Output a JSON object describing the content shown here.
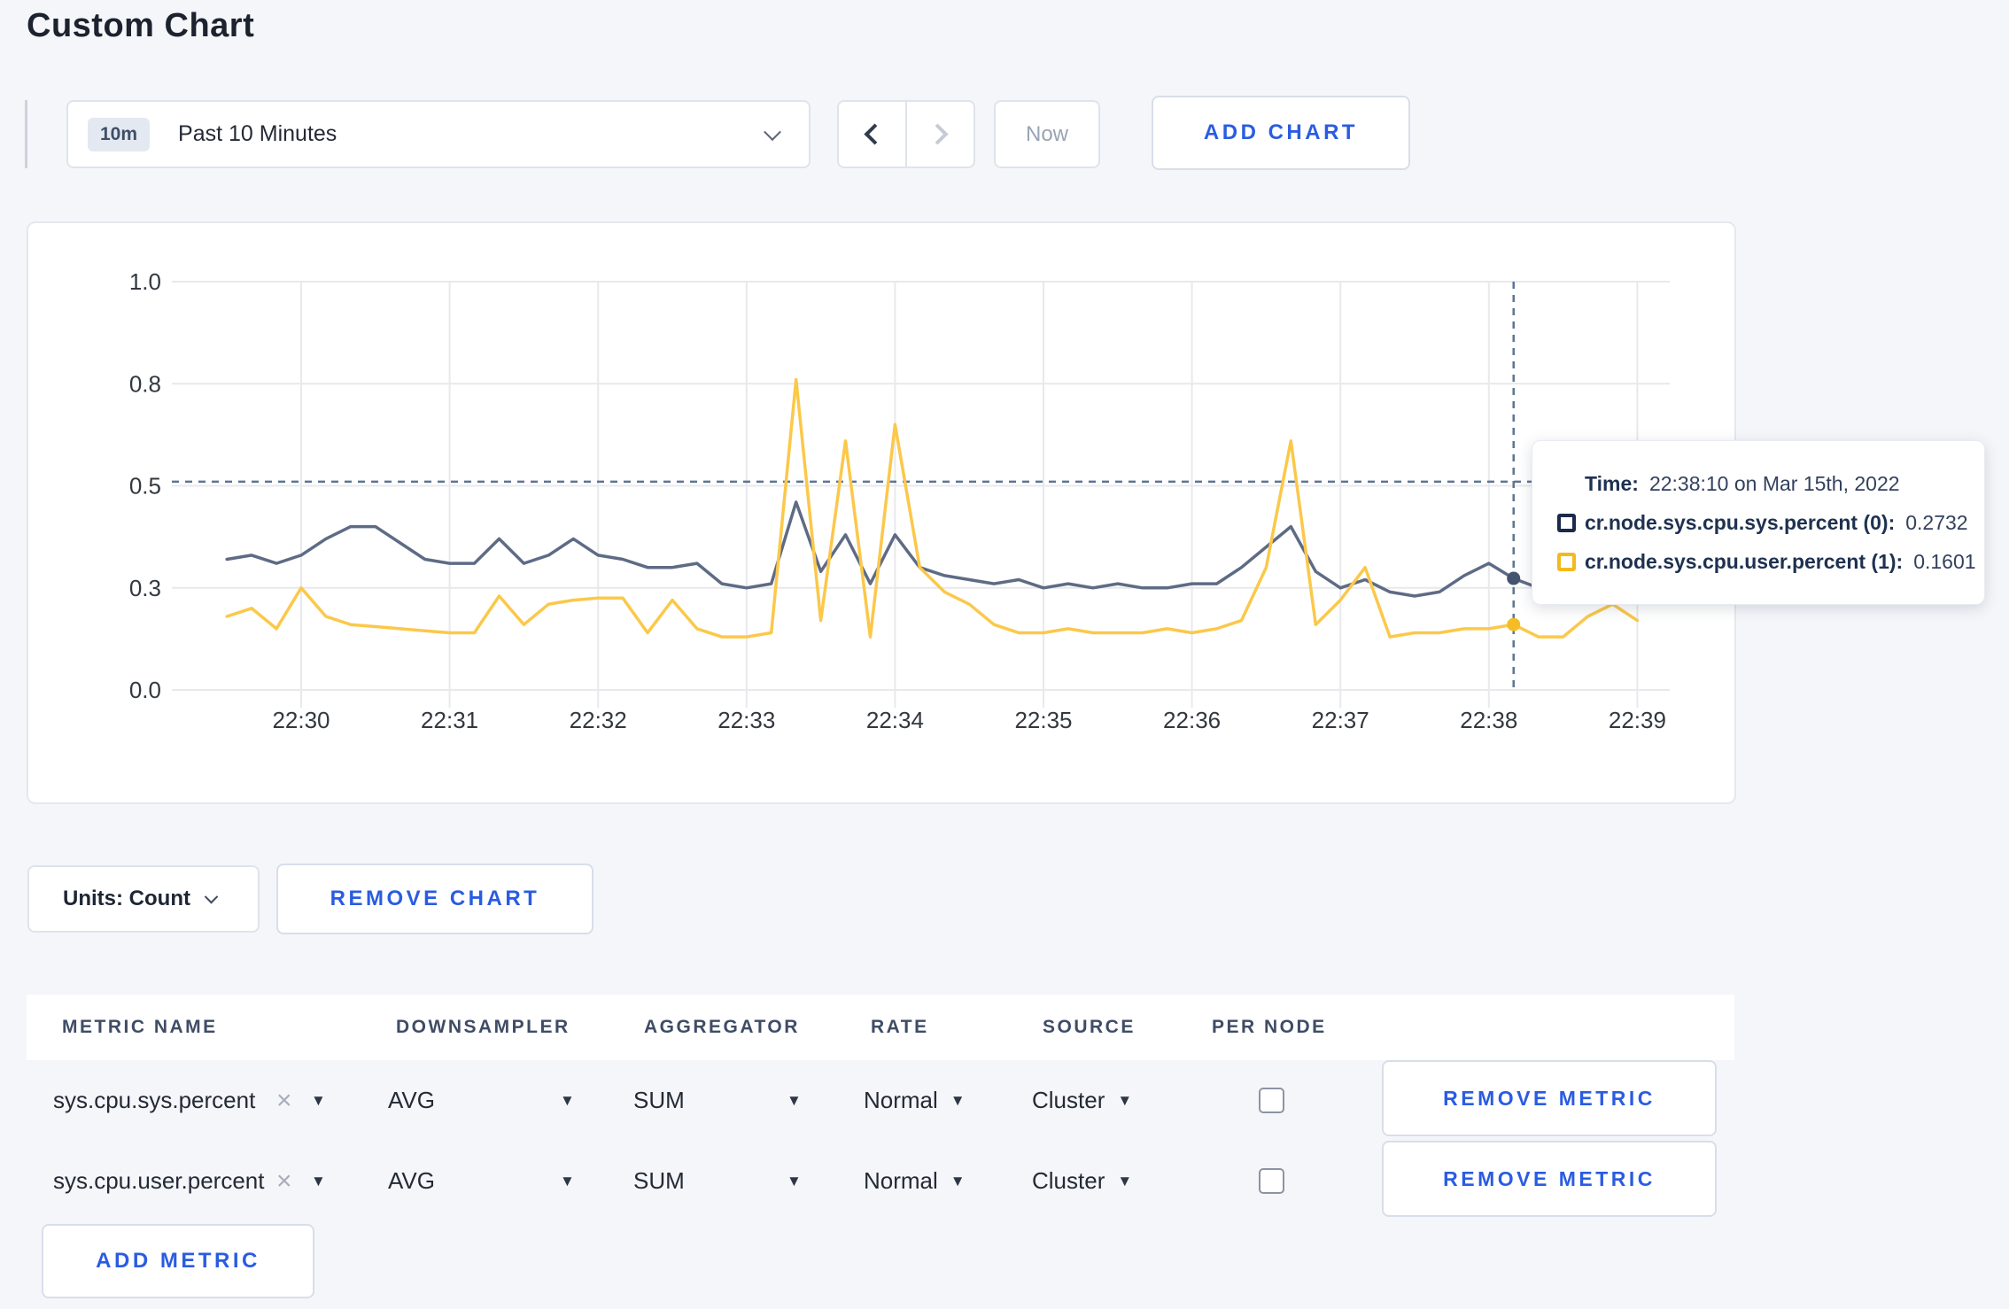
{
  "page": {
    "title": "Custom Chart",
    "background": "#f5f6fa"
  },
  "toolbar": {
    "time_window_badge": "10m",
    "time_window_label": "Past 10 Minutes",
    "now_label": "Now",
    "add_chart_label": "ADD CHART"
  },
  "chart": {
    "crosshair": {
      "time_offset_seconds": 520,
      "hline_value": 0.51
    },
    "tooltip": {
      "time_label": "Time:",
      "time_value": "22:38:10 on Mar 15th, 2022",
      "entries": [
        {
          "label": "cr.node.sys.cpu.sys.percent (0):",
          "value": "0.2732",
          "color": "#1b294b"
        },
        {
          "label": "cr.node.sys.cpu.user.percent (1):",
          "value": "0.1601",
          "color": "#f2ba1d"
        }
      ]
    }
  },
  "chart_data": {
    "type": "line",
    "title": "",
    "xlabel": "",
    "ylabel": "",
    "x_start": "22:29:30",
    "x_step_seconds": 10,
    "x_tick_labels": [
      "22:30",
      "22:31",
      "22:32",
      "22:33",
      "22:34",
      "22:35",
      "22:36",
      "22:37",
      "22:38",
      "22:39"
    ],
    "y_ticks": [
      {
        "label": "0.0",
        "value": 0
      },
      {
        "label": "0.3",
        "value": 0.25
      },
      {
        "label": "0.5",
        "value": 0.5
      },
      {
        "label": "0.8",
        "value": 0.75
      },
      {
        "label": "1.0",
        "value": 1
      }
    ],
    "ylim": [
      0,
      1
    ],
    "grid": true,
    "legend_position": "tooltip-only",
    "series": [
      {
        "name": "cr.node.sys.cpu.sys.percent",
        "color": "#5e6b85",
        "values": [
          0.32,
          0.33,
          0.31,
          0.33,
          0.37,
          0.4,
          0.4,
          0.36,
          0.32,
          0.31,
          0.31,
          0.37,
          0.31,
          0.33,
          0.37,
          0.33,
          0.32,
          0.3,
          0.3,
          0.31,
          0.26,
          0.25,
          0.26,
          0.46,
          0.29,
          0.38,
          0.26,
          0.38,
          0.3,
          0.28,
          0.27,
          0.26,
          0.27,
          0.25,
          0.26,
          0.25,
          0.26,
          0.25,
          0.25,
          0.26,
          0.26,
          0.3,
          0.35,
          0.4,
          0.29,
          0.25,
          0.27,
          0.24,
          0.23,
          0.24,
          0.28,
          0.31,
          0.2732,
          0.25,
          0.27,
          0.28,
          0.29,
          0.3
        ]
      },
      {
        "name": "cr.node.sys.cpu.user.percent",
        "color": "#fbc84a",
        "values": [
          0.18,
          0.2,
          0.15,
          0.25,
          0.18,
          0.16,
          0.155,
          0.15,
          0.145,
          0.14,
          0.14,
          0.23,
          0.16,
          0.21,
          0.22,
          0.225,
          0.225,
          0.14,
          0.22,
          0.15,
          0.13,
          0.13,
          0.14,
          0.76,
          0.17,
          0.61,
          0.13,
          0.65,
          0.3,
          0.24,
          0.21,
          0.16,
          0.14,
          0.14,
          0.15,
          0.14,
          0.14,
          0.14,
          0.15,
          0.14,
          0.15,
          0.17,
          0.3,
          0.61,
          0.16,
          0.22,
          0.3,
          0.13,
          0.14,
          0.14,
          0.15,
          0.15,
          0.1601,
          0.13,
          0.13,
          0.18,
          0.21,
          0.17
        ]
      }
    ],
    "highlight_point": {
      "time": "22:38:10",
      "cr.node.sys.cpu.sys.percent": 0.2732,
      "cr.node.sys.cpu.user.percent": 0.1601
    }
  },
  "units_bar": {
    "units_label": "Units: Count",
    "remove_chart_label": "REMOVE CHART"
  },
  "metrics_table": {
    "headers": [
      "METRIC NAME",
      "DOWNSAMPLER",
      "AGGREGATOR",
      "RATE",
      "SOURCE",
      "PER NODE"
    ],
    "rows": [
      {
        "metric": "sys.cpu.sys.percent",
        "clear_icon": "×",
        "downsampler": "AVG",
        "aggregator": "SUM",
        "rate": "Normal",
        "source": "Cluster",
        "per_node_checked": false,
        "remove_label": "REMOVE METRIC"
      },
      {
        "metric": "sys.cpu.user.percent",
        "clear_icon": "×",
        "downsampler": "AVG",
        "aggregator": "SUM",
        "rate": "Normal",
        "source": "Cluster",
        "per_node_checked": false,
        "remove_label": "REMOVE METRIC"
      }
    ],
    "add_metric_label": "ADD METRIC"
  },
  "colors": {
    "accent_blue": "#2a5ce2",
    "page_bg": "#f5f6fa",
    "card_border": "#e4e8ef",
    "grid_line": "#e8e9ec",
    "crosshair": "#5d7493",
    "series_sys": "#5e6b85",
    "series_user": "#fbc84a",
    "text_dark": "#242a35",
    "text_gray": "#9aa3b4",
    "tooltip_text": "#1e3150"
  }
}
